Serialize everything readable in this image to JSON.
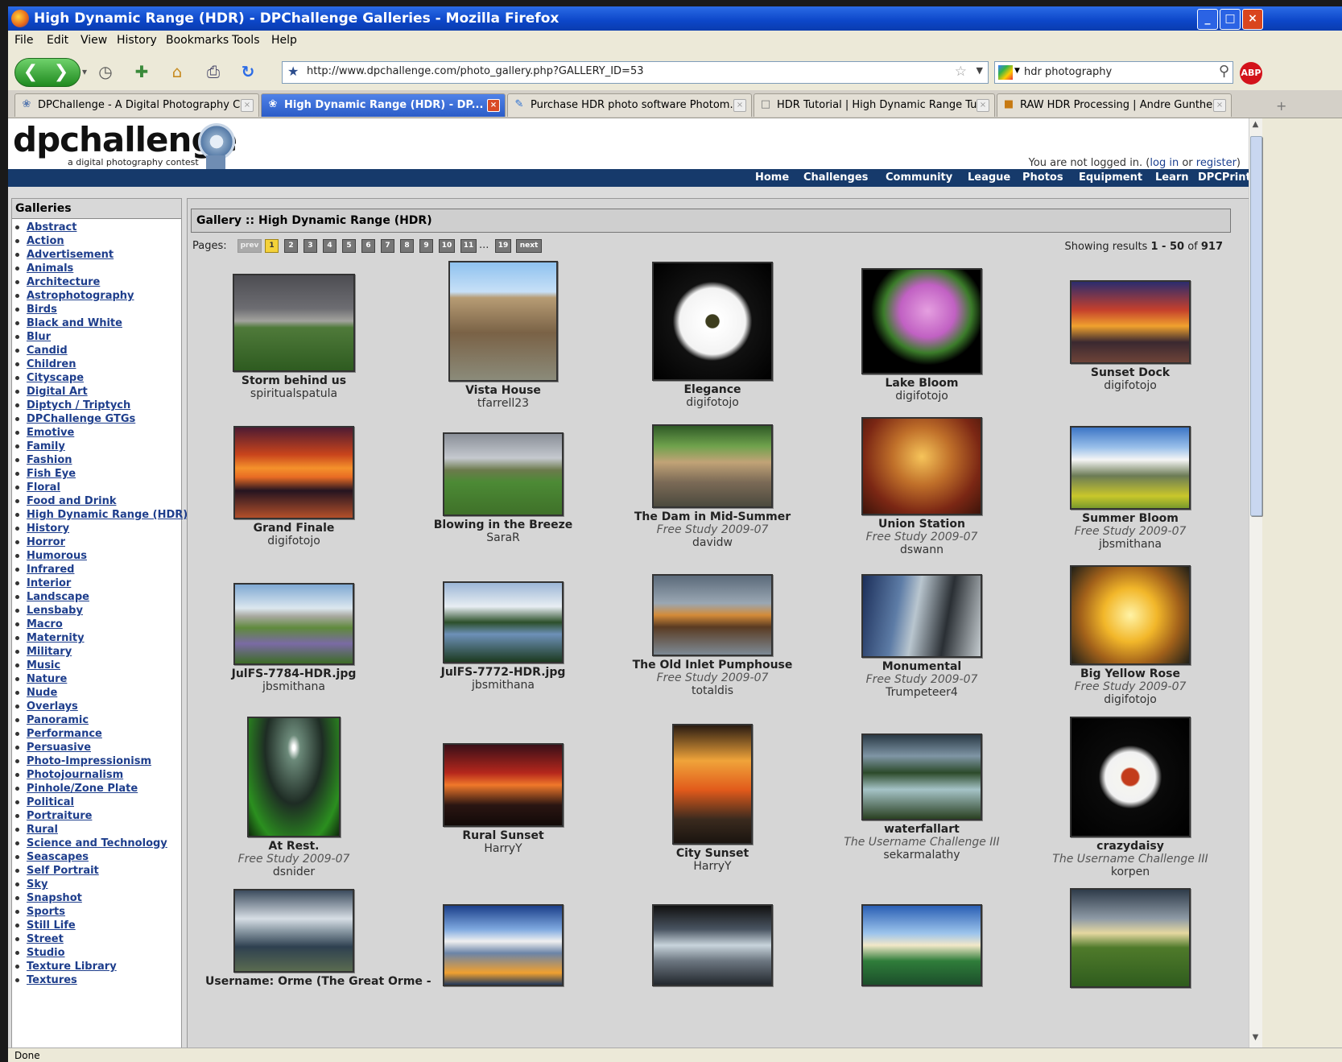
{
  "window": {
    "title": "High Dynamic Range (HDR) - DPChallenge Galleries - Mozilla Firefox",
    "buttons": {
      "minimize": "_",
      "maximize": "□",
      "close": "×"
    }
  },
  "menu": [
    "File",
    "Edit",
    "View",
    "History",
    "Bookmarks",
    "Tools",
    "Help"
  ],
  "toolbar": {
    "back_icon": "back-arrow-icon",
    "url": "http://www.dpchallenge.com/photo_gallery.php?GALLERY_ID=53",
    "search_value": "hdr photography",
    "abp_label": "ABP"
  },
  "tabs": [
    {
      "label": "DPChallenge - A Digital Photography C..."
    },
    {
      "label": "High Dynamic Range (HDR) - DP..."
    },
    {
      "label": "Purchase HDR photo software Photom..."
    },
    {
      "label": "HDR Tutorial | High Dynamic Range Tu..."
    },
    {
      "label": "RAW HDR Processing | Andre Gunther..."
    }
  ],
  "site": {
    "logo": "dpchallenge",
    "tagline": "a digital photography contest",
    "login_prefix": "You are not logged in. (",
    "login_link": "log in",
    "login_mid": " or ",
    "register_link": "register",
    "login_suffix": ")",
    "nav": [
      "Home",
      "Challenges",
      "Community",
      "League",
      "Photos",
      "Equipment",
      "Learn",
      "DPCPrints",
      "Help"
    ]
  },
  "sidebar": {
    "heading": "Galleries",
    "categories": [
      "Abstract",
      "Action",
      "Advertisement",
      "Animals",
      "Architecture",
      "Astrophotography",
      "Birds",
      "Black and White",
      "Blur",
      "Candid",
      "Children",
      "Cityscape",
      "Digital Art",
      "Diptych / Triptych",
      "DPChallenge GTGs",
      "Emotive",
      "Family",
      "Fashion",
      "Fish Eye",
      "Floral",
      "Food and Drink",
      "High Dynamic Range (HDR)",
      "History",
      "Horror",
      "Humorous",
      "Infrared",
      "Interior",
      "Landscape",
      "Lensbaby",
      "Macro",
      "Maternity",
      "Military",
      "Music",
      "Nature",
      "Nude",
      "Overlays",
      "Panoramic",
      "Performance",
      "Persuasive",
      "Photo-Impressionism",
      "Photojournalism",
      "Pinhole/Zone Plate",
      "Political",
      "Portraiture",
      "Rural",
      "Science and Technology",
      "Seascapes",
      "Self Portrait",
      "Sky",
      "Snapshot",
      "Sports",
      "Still Life",
      "Street",
      "Studio",
      "Texture Library",
      "Textures"
    ]
  },
  "gallery": {
    "title": "Gallery :: High Dynamic Range (HDR)",
    "pages_label": "Pages:",
    "prev_label": "prev",
    "next_label": "next",
    "page_numbers": [
      "1",
      "2",
      "3",
      "4",
      "5",
      "6",
      "7",
      "8",
      "9",
      "10",
      "11"
    ],
    "last_page": "19",
    "current_page": "1",
    "ellipsis": "...",
    "results_prefix": "Showing results ",
    "results_range": "1 - 50",
    "results_of": " of ",
    "results_total": "917",
    "items": [
      {
        "title": "Storm behind us",
        "challenge": "",
        "author": "spiritualspatula"
      },
      {
        "title": "Vista House",
        "challenge": "",
        "author": "tfarrell23"
      },
      {
        "title": "Elegance",
        "challenge": "",
        "author": "digifotojo"
      },
      {
        "title": "Lake Bloom",
        "challenge": "",
        "author": "digifotojo"
      },
      {
        "title": "Sunset Dock",
        "challenge": "",
        "author": "digifotojo"
      },
      {
        "title": "Grand Finale",
        "challenge": "",
        "author": "digifotojo"
      },
      {
        "title": "Blowing in the Breeze",
        "challenge": "",
        "author": "SaraR"
      },
      {
        "title": "The Dam in Mid-Summer",
        "challenge": "Free Study 2009-07",
        "author": "davidw"
      },
      {
        "title": "Union Station",
        "challenge": "Free Study 2009-07",
        "author": "dswann"
      },
      {
        "title": "Summer Bloom",
        "challenge": "Free Study 2009-07",
        "author": "jbsmithana"
      },
      {
        "title": "JulFS-7784-HDR.jpg",
        "challenge": "",
        "author": "jbsmithana"
      },
      {
        "title": "JulFS-7772-HDR.jpg",
        "challenge": "",
        "author": "jbsmithana"
      },
      {
        "title": "The Old Inlet Pumphouse",
        "challenge": "Free Study 2009-07",
        "author": "totaldis"
      },
      {
        "title": "Monumental",
        "challenge": "Free Study 2009-07",
        "author": "Trumpeteer4"
      },
      {
        "title": "Big Yellow Rose",
        "challenge": "Free Study 2009-07",
        "author": "digifotojo"
      },
      {
        "title": "At Rest.",
        "challenge": "Free Study 2009-07",
        "author": "dsnider"
      },
      {
        "title": "Rural Sunset",
        "challenge": "",
        "author": "HarryY"
      },
      {
        "title": "City Sunset",
        "challenge": "",
        "author": "HarryY"
      },
      {
        "title": "waterfallart",
        "challenge": "The Username Challenge III",
        "author": "sekarmalathy"
      },
      {
        "title": "crazydaisy",
        "challenge": "The Username Challenge III",
        "author": "korpen"
      },
      {
        "title": "Username: Orme (The Great Orme -",
        "challenge": "",
        "author": ""
      },
      {
        "title": "",
        "challenge": "",
        "author": ""
      },
      {
        "title": "",
        "challenge": "",
        "author": ""
      },
      {
        "title": "",
        "challenge": "",
        "author": ""
      },
      {
        "title": "",
        "challenge": "",
        "author": ""
      }
    ]
  },
  "status": "Done"
}
